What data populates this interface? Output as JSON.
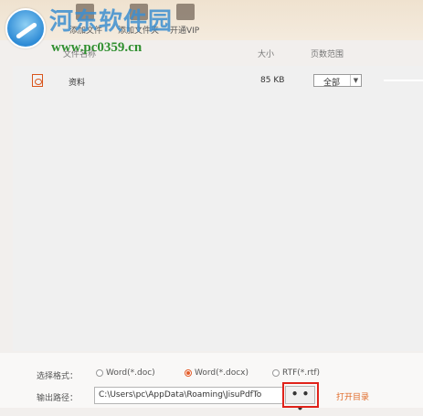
{
  "toolbar": {
    "items": [
      {
        "label": "添加文件"
      },
      {
        "label": "添加文件夹"
      },
      {
        "label": "开通VIP"
      }
    ]
  },
  "watermark": {
    "title": "河东软件园",
    "url": "www.pc0359.cn"
  },
  "columns": {
    "name": "文件名称",
    "size": "大小",
    "page_range": "页数范围"
  },
  "files": [
    {
      "name": "资料",
      "size": "85 KB",
      "page_range": "全部"
    }
  ],
  "bottom": {
    "format_label": "选择格式：",
    "formats": [
      {
        "label": "Word(*.doc)",
        "selected": false
      },
      {
        "label": "Word(*.docx)",
        "selected": true
      },
      {
        "label": "RTF(*.rtf)",
        "selected": false
      }
    ],
    "output_label": "输出路径：",
    "output_path": "C:\\Users\\pc\\AppData\\Roaming\\JisuPdfTo",
    "browse_label": "• • •",
    "open_dir_label": "打开目录"
  },
  "colors": {
    "accent": "#e35d2a",
    "highlight": "#e0221a"
  }
}
